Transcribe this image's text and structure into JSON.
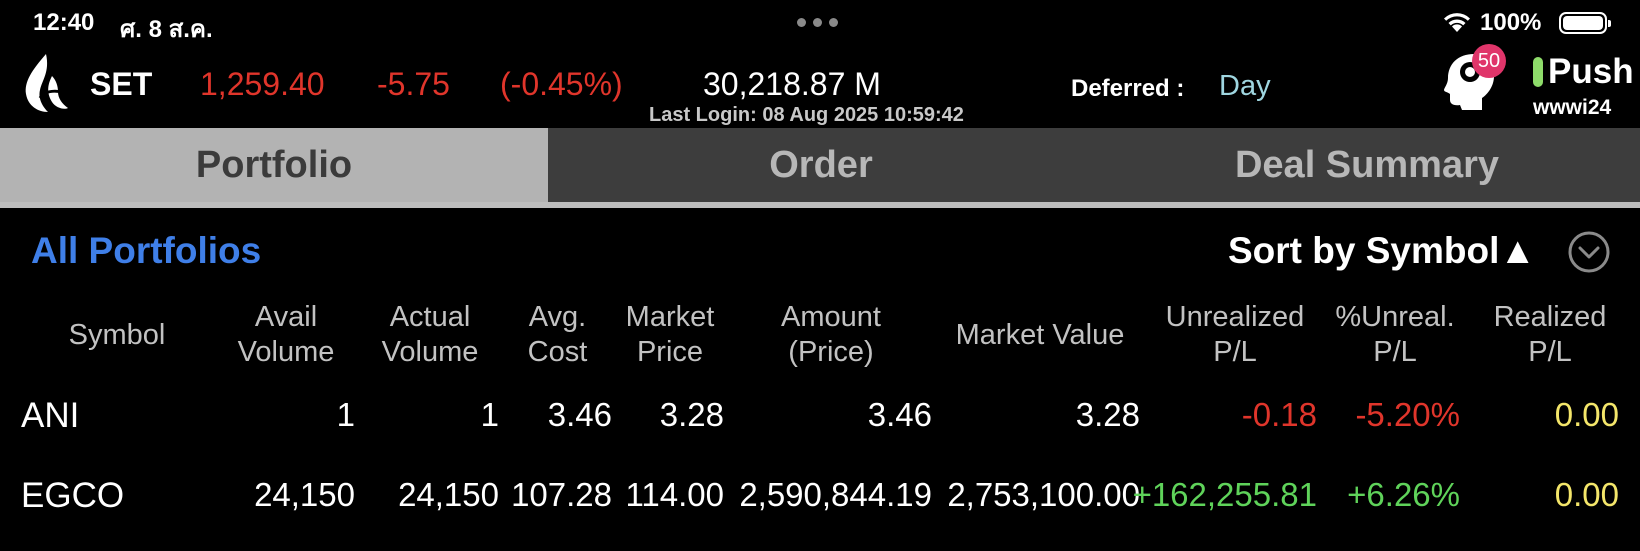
{
  "status_bar": {
    "time": "12:40",
    "date": "ศ. 8 ส.ค.",
    "battery": "100%"
  },
  "header": {
    "index_name": "SET",
    "index_value": "1,259.40",
    "change": "-5.75",
    "change_pct": "(-0.45%)",
    "volume": "30,218.87 M",
    "last_login": "Last Login: 08 Aug 2025 10:59:42",
    "deferred_label": "Deferred :",
    "deferred_value": "Day",
    "notification_count": "50",
    "push_label": "Push",
    "username": "wwwi24"
  },
  "tabs": [
    {
      "label": "Portfolio"
    },
    {
      "label": "Order"
    },
    {
      "label": "Deal Summary"
    }
  ],
  "portfolio_selector": "All Portfolios",
  "sort_label": "Sort by Symbol▲",
  "columns": {
    "symbol": "Symbol",
    "avail_volume": [
      "Avail",
      "Volume"
    ],
    "actual_volume": [
      "Actual",
      "Volume"
    ],
    "avg_cost": [
      "Avg.",
      "Cost"
    ],
    "market_price": [
      "Market",
      "Price"
    ],
    "amount": [
      "Amount",
      "(Price)"
    ],
    "market_value": "Market Value",
    "unrealized": [
      "Unrealized",
      "P/L"
    ],
    "pct_unreal": [
      "%Unreal.",
      "P/L"
    ],
    "realized": [
      "Realized",
      "P/L"
    ]
  },
  "rows": [
    {
      "symbol": "ANI",
      "avail_volume": "1",
      "actual_volume": "1",
      "avg_cost": "3.46",
      "market_price": "3.28",
      "amount": "3.46",
      "market_value": "3.28",
      "unrealized": "-0.18",
      "pct_unreal": "-5.20%",
      "realized": "0.00",
      "trend": "down"
    },
    {
      "symbol": "EGCO",
      "avail_volume": "24,150",
      "actual_volume": "24,150",
      "avg_cost": "107.28",
      "market_price": "114.00",
      "amount": "2,590,844.19",
      "market_value": "2,753,100.00",
      "unrealized": "+162,255.81",
      "pct_unreal": "+6.26%",
      "realized": "0.00",
      "trend": "up"
    }
  ],
  "colors": {
    "negative": "#e0352b",
    "positive": "#5fd35a",
    "realized": "#f4e66a",
    "link": "#3f7fe8",
    "deferred": "#9fd6e0"
  }
}
